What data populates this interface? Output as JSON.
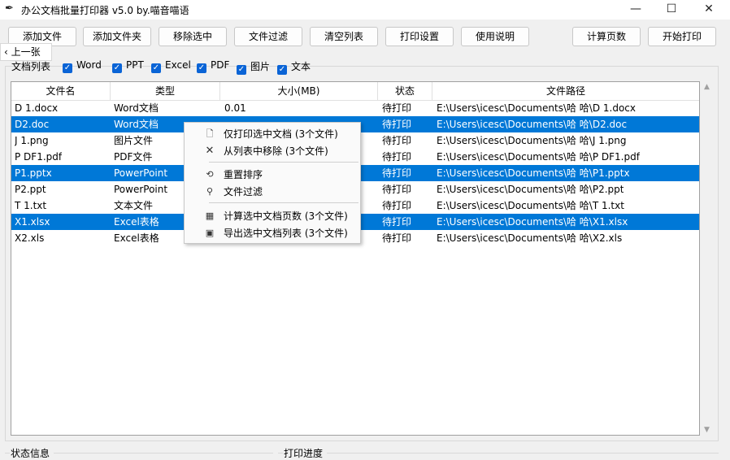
{
  "window": {
    "title": "办公文档批量打印器 v5.0 by.喵音喵语",
    "icons": {
      "app": "feather-icon",
      "minimize": "minimize-icon",
      "maximize": "maximize-icon",
      "close": "close-icon"
    }
  },
  "toolbar": {
    "add_files": "添加文件",
    "add_folder": "添加文件夹",
    "remove_selected": "移除选中",
    "file_filter": "文件过滤",
    "clear_list": "清空列表",
    "print_settings": "打印设置",
    "instructions": "使用说明",
    "count_pages": "计算页数",
    "start_print": "开始打印"
  },
  "prev_tip": {
    "label": "上一张",
    "icon": "chevron-left-icon"
  },
  "filters": {
    "label": "文档列表",
    "options": [
      {
        "label": "Word",
        "checked": true
      },
      {
        "label": "PPT",
        "checked": true
      },
      {
        "label": "Excel",
        "checked": true
      },
      {
        "label": "PDF",
        "checked": true
      },
      {
        "label": "图片",
        "checked": true
      },
      {
        "label": "文本",
        "checked": true
      }
    ]
  },
  "table": {
    "columns": [
      "文件名",
      "类型",
      "大小(MB)",
      "状态",
      "文件路径"
    ],
    "rows": [
      {
        "name": "D 1.docx",
        "type": "Word文档",
        "size": "0.01",
        "status": "待打印",
        "path": "E:\\Users\\icesc\\Documents\\哈 哈\\D 1.docx",
        "selected": false
      },
      {
        "name": "D2.doc",
        "type": "Word文档",
        "size": "",
        "status": "待打印",
        "path": "E:\\Users\\icesc\\Documents\\哈 哈\\D2.doc",
        "selected": true
      },
      {
        "name": "J 1.png",
        "type": "图片文件",
        "size": "",
        "status": "待打印",
        "path": "E:\\Users\\icesc\\Documents\\哈 哈\\J 1.png",
        "selected": false
      },
      {
        "name": "P DF1.pdf",
        "type": "PDF文件",
        "size": "",
        "status": "待打印",
        "path": "E:\\Users\\icesc\\Documents\\哈 哈\\P DF1.pdf",
        "selected": false
      },
      {
        "name": "P1.pptx",
        "type": "PowerPoint",
        "size": "",
        "status": "待打印",
        "path": "E:\\Users\\icesc\\Documents\\哈 哈\\P1.pptx",
        "selected": true
      },
      {
        "name": "P2.ppt",
        "type": "PowerPoint",
        "size": "",
        "status": "待打印",
        "path": "E:\\Users\\icesc\\Documents\\哈 哈\\P2.ppt",
        "selected": false
      },
      {
        "name": "T 1.txt",
        "type": "文本文件",
        "size": "",
        "status": "待打印",
        "path": "E:\\Users\\icesc\\Documents\\哈 哈\\T 1.txt",
        "selected": false
      },
      {
        "name": "X1.xlsx",
        "type": "Excel表格",
        "size": "",
        "status": "待打印",
        "path": "E:\\Users\\icesc\\Documents\\哈 哈\\X1.xlsx",
        "selected": true
      },
      {
        "name": "X2.xls",
        "type": "Excel表格",
        "size": "",
        "status": "待打印",
        "path": "E:\\Users\\icesc\\Documents\\哈 哈\\X2.xls",
        "selected": false
      }
    ]
  },
  "context_menu": {
    "items": [
      {
        "label": "仅打印选中文档 (3个文件)",
        "icon": "document-icon"
      },
      {
        "label": "从列表中移除 (3个文件)",
        "icon": "x-icon"
      },
      {
        "label": "重置排序",
        "icon": "reset-icon"
      },
      {
        "label": "文件过滤",
        "icon": "magnifier-icon"
      },
      {
        "label": "计算选中文档页数 (3个文件)",
        "icon": "bar-chart-icon"
      },
      {
        "label": "导出选中文档列表 (3个文件)",
        "icon": "floppy-disk-icon"
      }
    ]
  },
  "bottom": {
    "status_label": "状态信息",
    "progress_label": "打印进度"
  },
  "colors": {
    "selection": "#0078d7",
    "checkbox": "#0a64d6"
  }
}
